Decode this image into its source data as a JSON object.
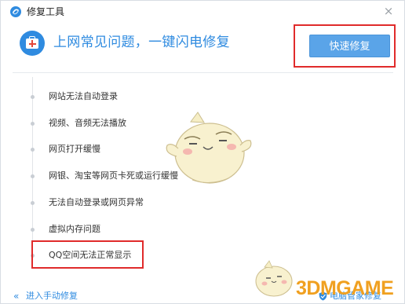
{
  "window": {
    "title": "修复工具",
    "close_label": "×"
  },
  "header": {
    "title": "上网常见问题，一键闪电修复",
    "quick_fix_label": "快速修复"
  },
  "problems": [
    {
      "label": "网站无法自动登录"
    },
    {
      "label": "视频、音频无法播放"
    },
    {
      "label": "网页打开缓慢"
    },
    {
      "label": "网银、淘宝等网页卡死或运行缓慢"
    },
    {
      "label": "无法自动登录或网页异常"
    },
    {
      "label": "虚拟内存问题"
    },
    {
      "label": "QQ空间无法正常显示"
    }
  ],
  "footer": {
    "manual_arrow": "«",
    "manual_label": "进入手动修复",
    "right_label": "电脑管家修复",
    "watermark": "3DMGAME"
  },
  "colors": {
    "accent": "#2f8be0",
    "button": "#5aa4e8",
    "highlight": "#e02b2b",
    "watermark": "#f0a020"
  }
}
